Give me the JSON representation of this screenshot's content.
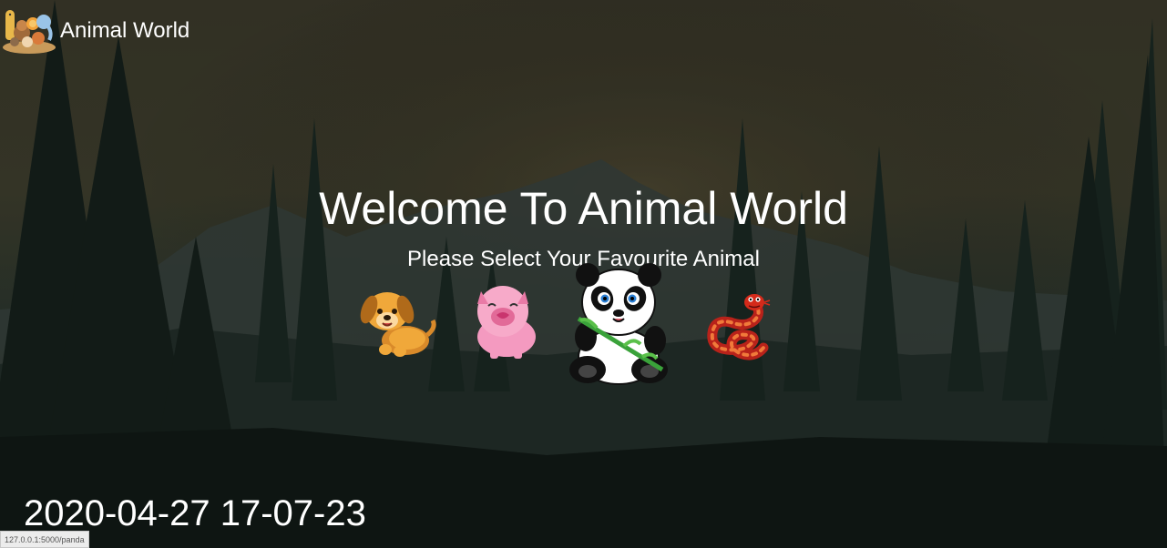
{
  "brand": {
    "name": "Animal World",
    "logo_icon": "animal-group-logo"
  },
  "hero": {
    "title": "Welcome To Animal World",
    "subtitle": "Please Select Your Favourite Animal"
  },
  "animals": [
    {
      "name": "dog",
      "icon": "dog-icon"
    },
    {
      "name": "pig",
      "icon": "pig-icon"
    },
    {
      "name": "panda",
      "icon": "panda-icon"
    },
    {
      "name": "snake",
      "icon": "snake-icon"
    }
  ],
  "timestamp": "2020-04-27 17-07-23",
  "status_bar": {
    "url": "127.0.0.1:5000/panda"
  },
  "colors": {
    "text": "#ffffff",
    "background_dark": "#1e2a26",
    "sky": "#3b3a2b"
  }
}
